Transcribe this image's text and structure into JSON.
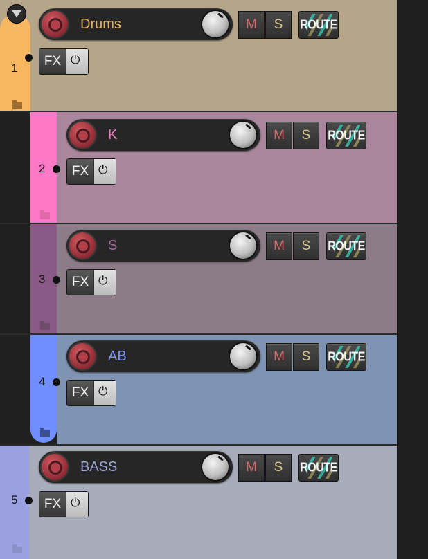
{
  "controls": {
    "mute_label": "M",
    "solo_label": "S",
    "route_label": "ROUTE",
    "fx_label": "FX",
    "power_icon": "power-icon"
  },
  "tracks": [
    {
      "number": "1",
      "name": "Drums",
      "name_color": "#e7b15f",
      "bg": "#b5a68a",
      "strip": "#f7b760"
    },
    {
      "number": "2",
      "name": "K",
      "name_color": "#f27cc3",
      "bg": "#a9869c",
      "strip": "#ff79c8"
    },
    {
      "number": "3",
      "name": "S",
      "name_color": "#a86a95",
      "bg": "#8c7c87",
      "strip": "#8a5a86"
    },
    {
      "number": "4",
      "name": "AB",
      "name_color": "#7d96f2",
      "bg": "#7f93b3",
      "strip": "#6f8fff"
    },
    {
      "number": "5",
      "name": "BASS",
      "name_color": "#9ea5d8",
      "bg": "#a6acb9",
      "strip": "#9ba0e0"
    }
  ]
}
